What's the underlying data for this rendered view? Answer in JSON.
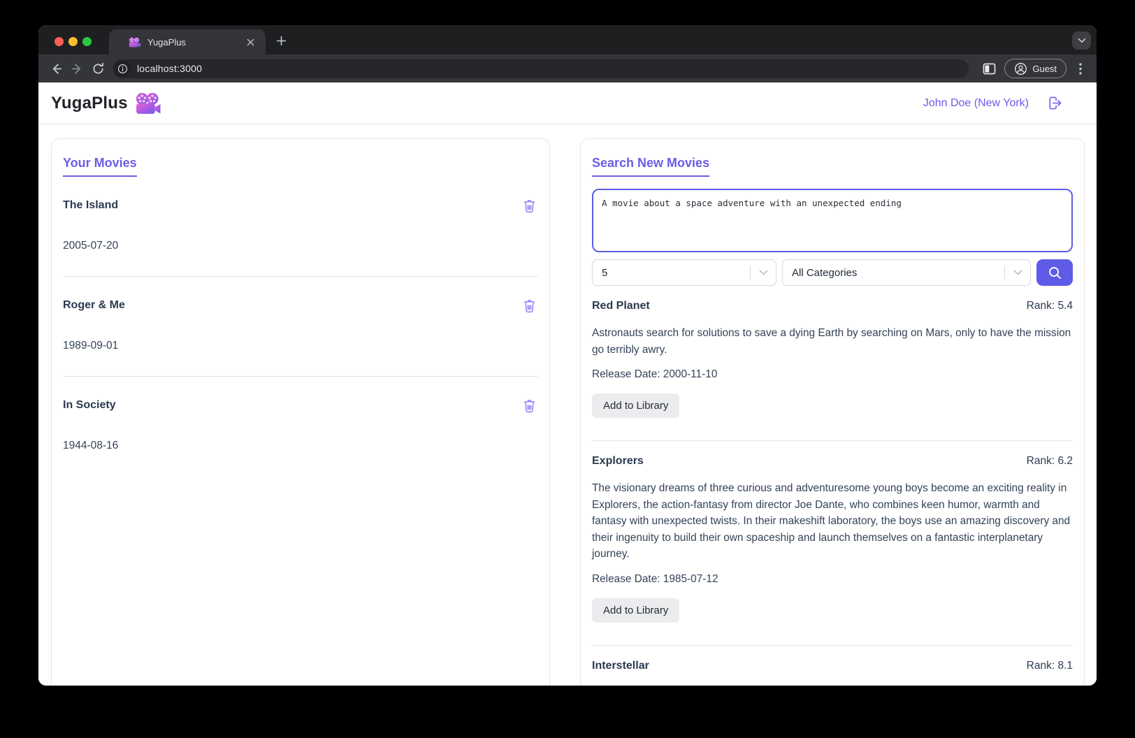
{
  "browser": {
    "tab_title": "YugaPlus",
    "url": "localhost:3000",
    "profile_label": "Guest"
  },
  "header": {
    "app_name": "YugaPlus",
    "user_label": "John Doe (New York)"
  },
  "library": {
    "title": "Your Movies",
    "movies": [
      {
        "title": "The Island",
        "date": "2005-07-20"
      },
      {
        "title": "Roger & Me",
        "date": "1989-09-01"
      },
      {
        "title": "In Society",
        "date": "1944-08-16"
      }
    ]
  },
  "search": {
    "title": "Search New Movies",
    "query": "A movie about a space adventure with an unexpected ending",
    "limit_value": "5",
    "category_value": "All Categories",
    "add_button_label": "Add to Library",
    "results": [
      {
        "title": "Red Planet",
        "rank_label": "Rank: 5.4",
        "description": "Astronauts search for solutions to save a dying Earth by searching on Mars, only to have the mission go terribly awry.",
        "release_label": "Release Date: 2000-11-10"
      },
      {
        "title": "Explorers",
        "rank_label": "Rank: 6.2",
        "description": "The visionary dreams of three curious and adventuresome young boys become an exciting reality in Explorers, the action-fantasy from director Joe Dante, who combines keen humor, warmth and fantasy with unexpected twists. In their makeshift laboratory, the boys use an amazing discovery and their ingenuity to build their own spaceship and launch themselves on a fantastic interplanetary journey.",
        "release_label": "Release Date: 1985-07-12"
      },
      {
        "title": "Interstellar",
        "rank_label": "Rank: 8.1"
      }
    ]
  },
  "icons": {
    "favicon": "movie-camera",
    "brand": "movie-camera",
    "logout": "door-arrow-sign-out",
    "delete": "trash-can",
    "search": "magnifier",
    "select": "chevron-down"
  },
  "colors": {
    "accent": "#6c5ce7",
    "accent_strong": "#5e5ce6",
    "trash_icon": "#8d7ff2",
    "title_text": "#2c3a50",
    "body_text": "#344358",
    "chrome_frame": "#1e1f21",
    "chrome_surface": "#343539",
    "traffic_red": "#ff5f57",
    "traffic_yellow": "#febc2e",
    "traffic_green": "#28c840"
  }
}
